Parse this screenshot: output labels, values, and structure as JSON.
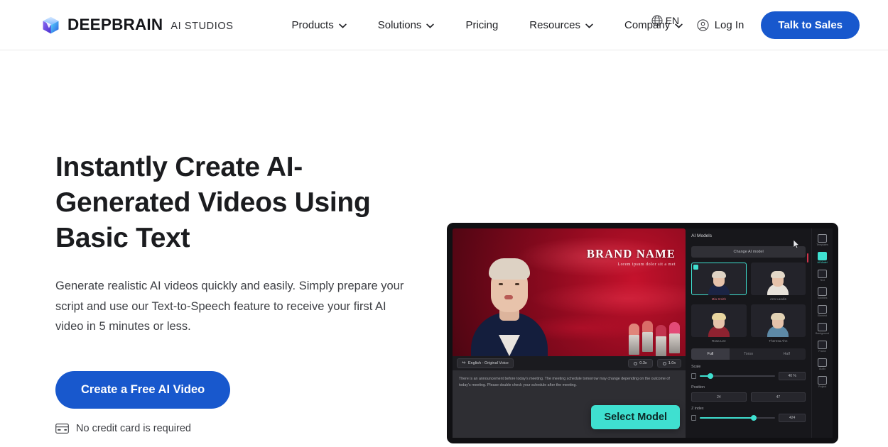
{
  "header": {
    "brand_name": "DEEPBRAIN",
    "brand_sub": "AI STUDIOS",
    "logo_icon": "cube-logo-icon",
    "nav": [
      {
        "label": "Products",
        "has_chevron": true
      },
      {
        "label": "Solutions",
        "has_chevron": true
      },
      {
        "label": "Pricing",
        "has_chevron": false
      },
      {
        "label": "Resources",
        "has_chevron": true
      },
      {
        "label": "Company",
        "has_chevron": true
      }
    ],
    "language": {
      "code": "EN",
      "icon": "globe-icon"
    },
    "login": {
      "label": "Log In",
      "icon": "user-circle-icon"
    },
    "cta": {
      "label": "Talk to Sales"
    }
  },
  "hero": {
    "headline": "Instantly Create AI-Generated Videos Using Basic Text",
    "subcopy": "Generate realistic AI videos quickly and easily. Simply prepare your script and use our Text-to-Speech feature to receive your first AI video in 5 minutes or less.",
    "cta_label": "Create a Free AI Video",
    "note": "No credit card is required",
    "note_icon": "credit-card-icon"
  },
  "editor": {
    "stage": {
      "brand_title": "BRAND NAME",
      "brand_tagline": "Lorem ipsum dolor sit a met"
    },
    "toolbar": {
      "language_chip": "English - Original Voice",
      "language_icon": "waveform-icon",
      "time_chips": [
        "0.3x",
        "1.0x"
      ],
      "time_icon": "clock-icon"
    },
    "script": "There is an announcement before today's meeting. The meeting schedule tomorrow may change depending on the outcome of today's meeting. Please double check your schedule after the meeting.",
    "select_model_label": "Select Model",
    "panel": {
      "title": "AI Models",
      "change_button": "Change AI model",
      "models": [
        {
          "name": "Mia Smith",
          "selected": true,
          "hair": "#ded3c4",
          "top": "#1b2444"
        },
        {
          "name": "Ann Landis",
          "selected": false,
          "hair": "#e3d8c8",
          "top": "#e7e2da"
        },
        {
          "name": "Rosa Lee",
          "selected": false,
          "hair": "#e8d59f",
          "top": "#8e2230"
        },
        {
          "name": "Theresa Ahn",
          "selected": false,
          "hair": "#e2d2b4",
          "top": "#5d89a6"
        }
      ],
      "segments": [
        {
          "label": "Full",
          "active": true
        },
        {
          "label": "Torso",
          "active": false
        },
        {
          "label": "Half",
          "active": false
        }
      ],
      "controls": [
        {
          "label": "Scale",
          "value": "40 %",
          "fill_pct": 14,
          "knob_pct": 14
        },
        {
          "label": "Position",
          "x": "24",
          "y": "47"
        },
        {
          "label": "Z index",
          "value": "424",
          "fill_pct": 72,
          "knob_pct": 72
        }
      ]
    },
    "rail": [
      {
        "label": "Templates",
        "active": false
      },
      {
        "label": "AI Model",
        "active": true
      },
      {
        "label": "Text",
        "active": false
      },
      {
        "label": "Subtitles",
        "active": false
      },
      {
        "label": "Element",
        "active": false
      },
      {
        "label": "Background",
        "active": false
      },
      {
        "label": "Frame",
        "active": false
      },
      {
        "label": "Audio",
        "active": false
      },
      {
        "label": "Project",
        "active": false
      }
    ]
  },
  "colors": {
    "brand_blue": "#1858cd",
    "accent_teal": "#3fe0d0",
    "text_dark": "#1b1c1f",
    "text_muted": "#3e4045"
  }
}
